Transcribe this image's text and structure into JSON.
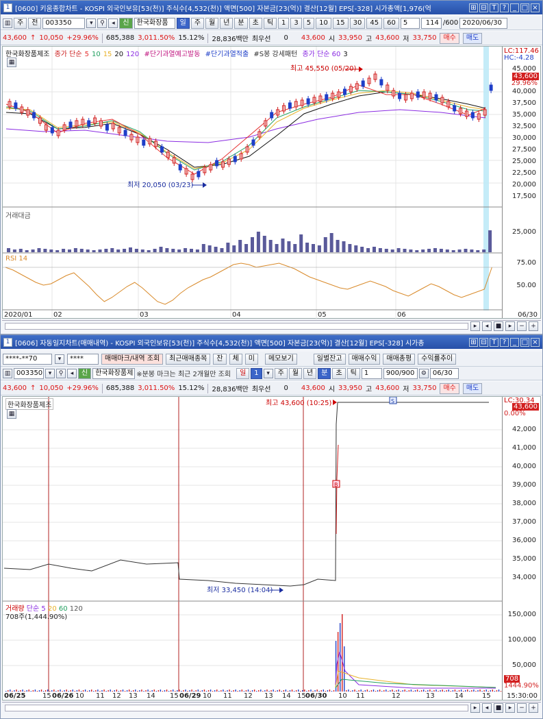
{
  "w1": {
    "title": "[0600] 키움종합차트 - KOSPI 외국인보유[53(천)] 주식수[4,532(천)] 액면[500] 자본금[23(억)] 결산[12월] EPS[-328] 시가총액[1,976(억",
    "num": "1",
    "tb1": {
      "code": "003350",
      "name": "한국화장품",
      "sin": "신",
      "periods": [
        "일",
        "주",
        "월",
        "년",
        "분",
        "초",
        "틱"
      ],
      "mins": [
        "1",
        "3",
        "5",
        "10",
        "15",
        "30",
        "45",
        "60"
      ],
      "n": "5",
      "count": "114",
      "total": "/600",
      "date": "2020/06/30",
      "jeon": "전",
      "ju": "주"
    },
    "tb2": {
      "price": "43,600",
      "arrow": "↑",
      "chg": "10,050",
      "pct": "+29.96%",
      "vol": "685,388",
      "volpct": "3,011.50%",
      "turnover": "15.12%",
      "amt": "28,836백만",
      "pref": "최우선",
      "zero": "0",
      "ask": "43,600",
      "open_l": "시",
      "open": "33,950",
      "high_l": "고",
      "high": "43,600",
      "low_l": "저",
      "low": "33,750",
      "buy": "매수",
      "sell": "매도"
    },
    "legend": {
      "name": "한국화장품제조",
      "ma": "종가 단순",
      "m5": "5",
      "m10": "10",
      "m15": "15",
      "m20": "20",
      "m120": "120",
      "s1": "#단기과열예고발동",
      "s2": "#단기과열적출",
      "s3": "#S봉 강세패턴",
      "vma": "종가 단순 60",
      "vma2": "3"
    },
    "lc": "LC:117.46",
    "hc": "HC:-4.28",
    "high_mark": "최고 45,550 (05/20)",
    "low_mark": "최저 20,050 (03/23)",
    "yticks": [
      "45,000",
      "40,000",
      "37,500",
      "35,000",
      "32,500",
      "30,000",
      "27,500",
      "25,000",
      "22,500",
      "20,000",
      "17,500"
    ],
    "price_tag": "43,600",
    "pct_tag": "29.96%",
    "vol_label": "거래대금",
    "vol_tick": "25,000",
    "rsi_label": "RSI 14",
    "rsi_ticks": [
      "75.00",
      "50.00"
    ],
    "xticks": [
      "2020/01",
      "02",
      "03",
      "04",
      "05",
      "06"
    ],
    "date_corner": "06/30"
  },
  "w2": {
    "title": "[0606] 자동일지차트(매매내역) - KOSPI 외국인보유[53(천)] 주식수[4,532(천)] 액면[500] 자본금[23(억)] 결산[12월] EPS[-328] 시가총",
    "num": "1",
    "tb0": {
      "acct": "****-**70",
      "pw": "****",
      "b1": "매매마크/내역 조회",
      "b2": "최근매매종목",
      "b3": "잔",
      "b4": "체",
      "b5": "미",
      "b6": "메모보기",
      "b7": "일별잔고",
      "b8": "매매수익",
      "b9": "매매총평",
      "b10": "수익률추이"
    },
    "tb1": {
      "code": "003350",
      "name": "한국화장품제",
      "sin": "신",
      "note": "※분봉 마크는 최근 2개월만 조회",
      "day": "일",
      "one": "1",
      "periods": [
        "주",
        "월",
        "년",
        "분",
        "초",
        "틱"
      ],
      "n": "1",
      "count": "900/900",
      "date": "06/30"
    },
    "tb2": {
      "price": "43,600",
      "arrow": "↑",
      "chg": "10,050",
      "pct": "+29.96%",
      "vol": "685,388",
      "volpct": "3,011.50%",
      "turnover": "15.12%",
      "amt": "28,836백만",
      "pref": "최우선",
      "zero": "0",
      "ask": "43,600",
      "open_l": "시",
      "open": "33,950",
      "high_l": "고",
      "high": "43,600",
      "low_l": "저",
      "low": "33,750",
      "buy": "매수",
      "sell": "매도"
    },
    "legend": "한국화장품제조",
    "lc": "LC:30.34",
    "price_tag": "43,600",
    "pct_tag": "0.00%",
    "high_mark": "최고 43,600 (10:25)",
    "low_mark": "최저 33,450 (14:04)",
    "yticks": [
      "42,000",
      "41,000",
      "40,000",
      "39,000",
      "38,000",
      "37,000",
      "36,000",
      "35,000",
      "34,000"
    ],
    "vol_legend": {
      "a": "거래량",
      "b": "단순",
      "c": "5",
      "d": "20",
      "e": "60",
      "f": "120"
    },
    "vol_sub": "708주(1,444.90%)",
    "vol_ticks": [
      "150,000",
      "100,000",
      "50,000"
    ],
    "vol_tag": "708",
    "vol_tag2": "1444.90%",
    "xticks": [
      "06/25",
      "15",
      "06/26",
      "10",
      "11",
      "12",
      "13",
      "14",
      "15",
      "06/29",
      "10",
      "11",
      "12",
      "13",
      "14",
      "15",
      "06/30",
      "10",
      "11",
      "12",
      "13",
      "14",
      "15"
    ],
    "time_corner": "15:30:00",
    "b_mark": "B",
    "s_mark": "S"
  },
  "colors": {
    "up": "#d21f1f",
    "down": "#1f3fc8",
    "bar": "#5a5a9a",
    "rsi": "#d98a2a",
    "title": "#2750a8"
  }
}
